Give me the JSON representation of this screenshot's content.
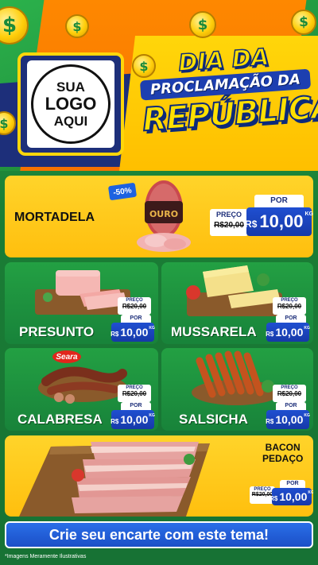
{
  "header": {
    "logo_placeholder": [
      "SUA",
      "LOGO",
      "AQUI"
    ],
    "title_line1": "DIA DA",
    "title_line2": "PROCLAMAÇÃO DA",
    "title_line3": "REPÚBLICA",
    "coin_symbol": "$"
  },
  "labels": {
    "preco": "PREÇO",
    "por": "POR",
    "old_price": "R$20,00",
    "currency": "R$",
    "price": "10,00",
    "unit": "KG"
  },
  "products": [
    {
      "name": "MORTADELA",
      "discount": "-50%",
      "brand": "OURO"
    },
    {
      "name": "PRESUNTO"
    },
    {
      "name": "MUSSARELA"
    },
    {
      "name": "CALABRESA",
      "brand": "Seara"
    },
    {
      "name": "SALSICHA"
    },
    {
      "name": "BACON\nPEDAÇO",
      "name_line1": "BACON",
      "name_line2": "PEDAÇO"
    }
  ],
  "footer": {
    "cta": "Crie seu encarte com este tema!",
    "disclaimer": "*Imagens Meramente Ilustrativas"
  },
  "colors": {
    "green": "#1f8a3a",
    "orange": "#ff8a00",
    "yellow": "#ffd42a",
    "navy": "#1d2f7a",
    "blue": "#1f4fd1"
  }
}
